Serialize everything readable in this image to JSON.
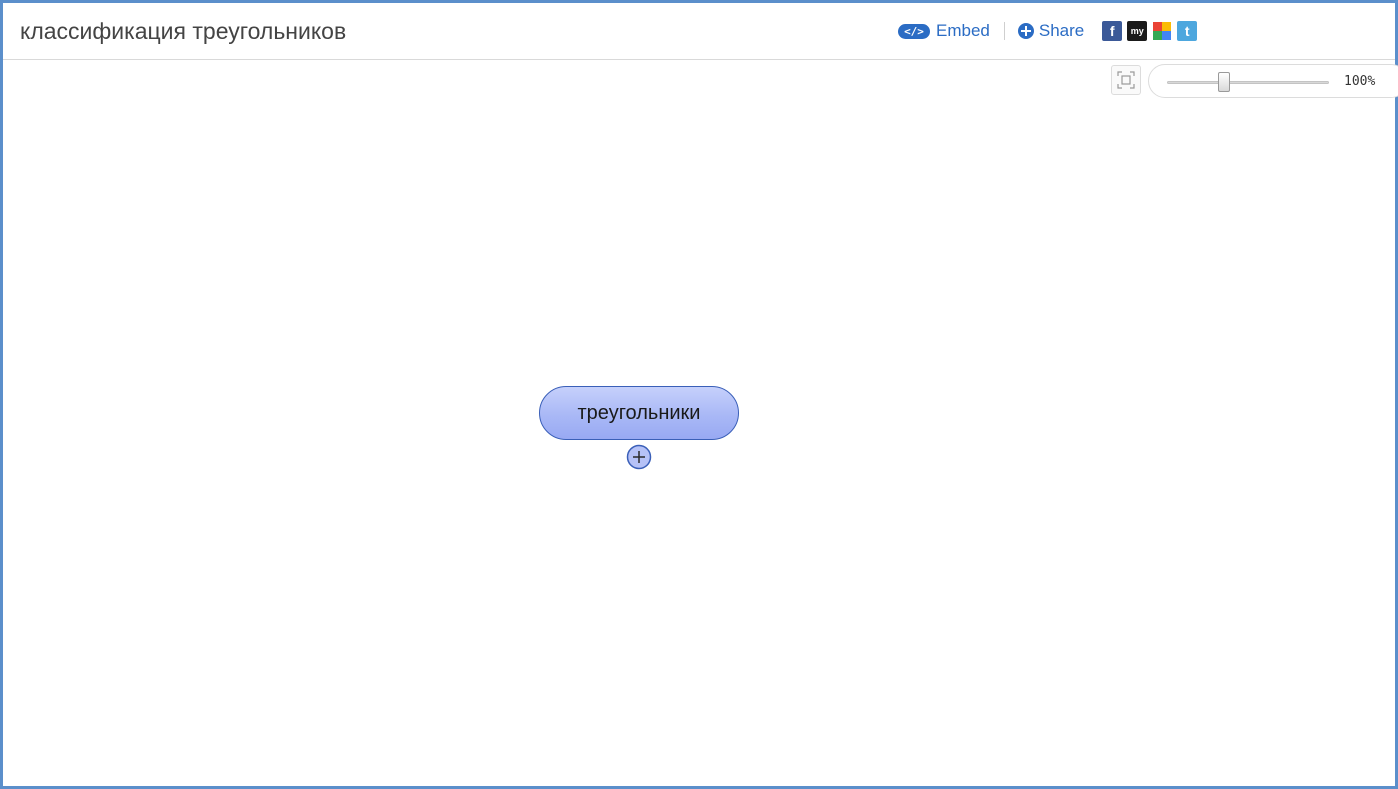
{
  "header": {
    "title": "классификация треугольников",
    "embed_label": "Embed",
    "embed_icon_text": "</>",
    "share_label": "Share"
  },
  "social": {
    "facebook_text": "f",
    "myspace_text": "my",
    "twitter_text": "t"
  },
  "zoom": {
    "value_label": "100%",
    "level": 0.35
  },
  "mindmap": {
    "root_node_label": "треугольники"
  },
  "colors": {
    "frame_border": "#5b8fcb",
    "link": "#2b6cc4",
    "node_fill": "#a9b8f6",
    "node_border": "#3a5fb8"
  }
}
